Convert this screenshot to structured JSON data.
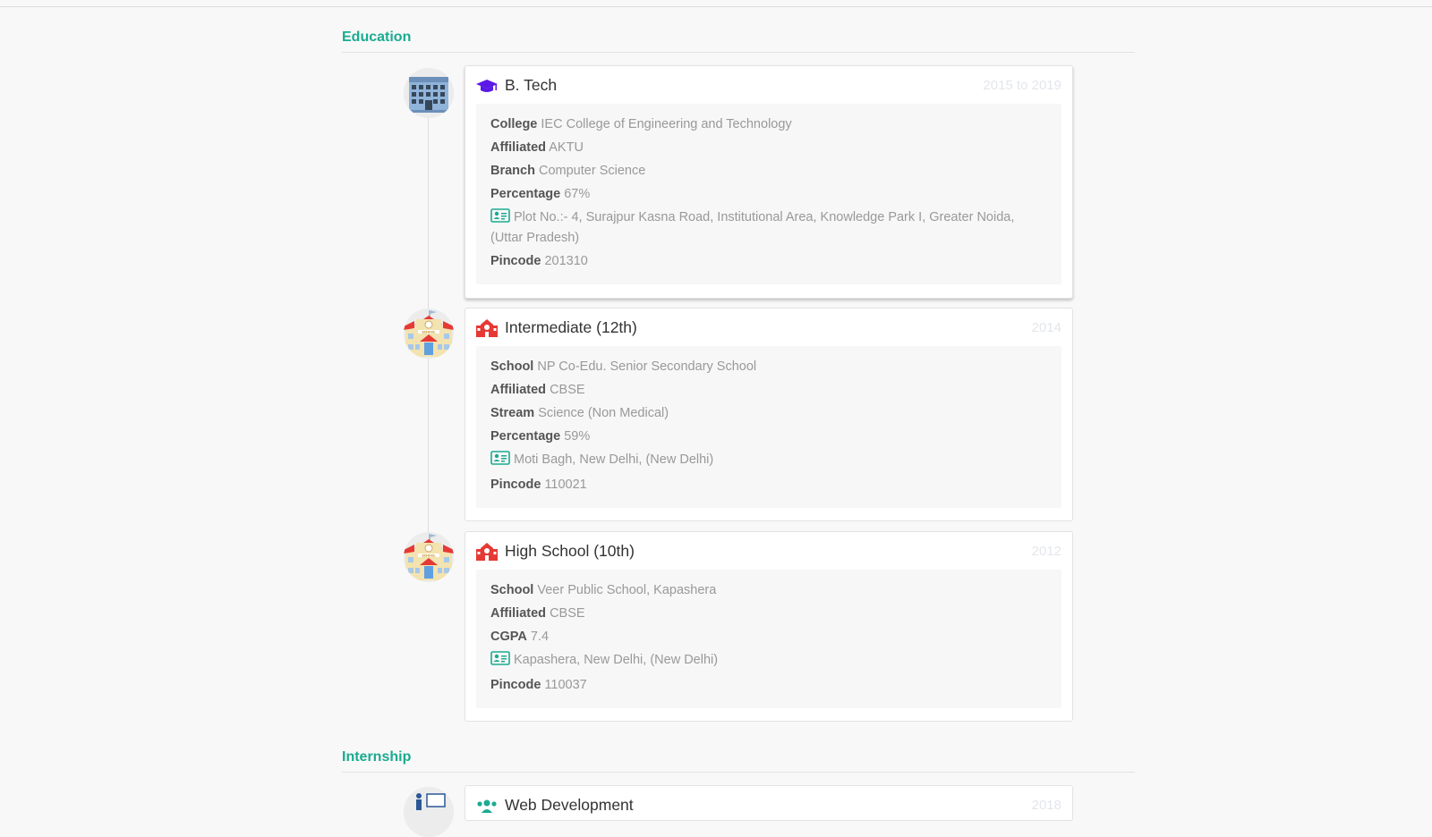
{
  "sections": {
    "education": "Education",
    "internship": "Internship"
  },
  "education": [
    {
      "title": "B. Tech",
      "years": "2015 to 2019",
      "rows": [
        {
          "label": "College",
          "value": "IEC College of Engineering and Technology"
        },
        {
          "label": "Affiliated",
          "value": "AKTU"
        },
        {
          "label": "Branch",
          "value": "Computer Science"
        },
        {
          "label": "Percentage",
          "value": "67%"
        }
      ],
      "address": "Plot No.:- 4, Surajpur Kasna Road, Institutional Area, Knowledge Park I, Greater Noida, (Uttar Pradesh)",
      "pincode_label": "Pincode",
      "pincode": "201310"
    },
    {
      "title": "Intermediate (12th)",
      "years": "2014",
      "rows": [
        {
          "label": "School",
          "value": "NP Co-Edu. Senior Secondary School"
        },
        {
          "label": "Affiliated",
          "value": "CBSE"
        },
        {
          "label": "Stream",
          "value": "Science (Non Medical)"
        },
        {
          "label": "Percentage",
          "value": "59%"
        }
      ],
      "address": "Moti Bagh, New Delhi, (New Delhi)",
      "pincode_label": "Pincode",
      "pincode": "110021"
    },
    {
      "title": "High School (10th)",
      "years": "2012",
      "rows": [
        {
          "label": "School",
          "value": "Veer Public School, Kapashera"
        },
        {
          "label": "Affiliated",
          "value": "CBSE"
        },
        {
          "label": "CGPA",
          "value": "7.4"
        }
      ],
      "address": "Kapashera, New Delhi, (New Delhi)",
      "pincode_label": "Pincode",
      "pincode": "110037"
    }
  ],
  "internship": [
    {
      "title": "Web Development",
      "years": "2018"
    }
  ],
  "icons": {
    "btech_avatar": "college-building-icon",
    "school_avatar": "school-building-icon",
    "btech_title": "graduation-cap-icon",
    "school_title": "school-icon",
    "address": "id-card-icon",
    "intern_avatar": "presentation-icon",
    "intern_title": "users-icon"
  },
  "colors": {
    "accent": "#1aab91",
    "cap": "#5b19e6",
    "school": "#e53935"
  }
}
